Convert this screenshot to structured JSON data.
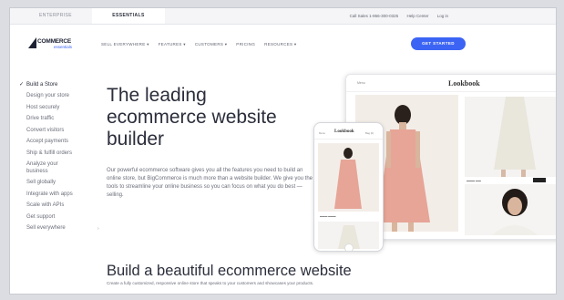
{
  "utility_bar": {
    "tabs": [
      {
        "label": "ENTERPRISE"
      },
      {
        "label": "ESSENTIALS"
      }
    ],
    "right_links": [
      {
        "label": "Call Sales 1-866-300-0325"
      },
      {
        "label": "Help Center"
      },
      {
        "label": "Log in"
      }
    ]
  },
  "header": {
    "logo": {
      "wordmark": "COMMERCE",
      "sub": "essentials"
    },
    "nav": [
      {
        "label": "SELL EVERYWHERE ▾"
      },
      {
        "label": "FEATURES ▾"
      },
      {
        "label": "CUSTOMERS ▾"
      },
      {
        "label": "PRICING"
      },
      {
        "label": "RESOURCES ▾"
      }
    ],
    "cta": "GET STARTED"
  },
  "sidebar": {
    "items": [
      {
        "label": "Build a Store",
        "active": true
      },
      {
        "label": "Design your store"
      },
      {
        "label": "Host securely"
      },
      {
        "label": "Drive traffic"
      },
      {
        "label": "Convert visitors"
      },
      {
        "label": "Accept payments"
      },
      {
        "label": "Ship & fulfill orders"
      },
      {
        "label": "Analyze your business"
      },
      {
        "label": "Sell globally"
      },
      {
        "label": "Integrate with apps"
      },
      {
        "label": "Scale with APIs"
      },
      {
        "label": "Get support"
      },
      {
        "label": "Sell everywhere"
      }
    ],
    "check_glyph": "✓",
    "chevron_glyph": "›"
  },
  "hero": {
    "title_line1": "The leading",
    "title_line2": "ecommerce website",
    "title_line3": "builder",
    "body": "Our powerful ecommerce software gives you all the features you need to build an online store, but BigCommerce is much more than a website builder. We give you the tools to streamline your online business so you can focus on what you do best — selling."
  },
  "section2": {
    "title": "Build a beautiful ecommerce website",
    "body": "Create a fully customized, responsive online store that speaks to your customers and showcases your products."
  },
  "mockups": {
    "desktop_title": "Lookbook",
    "desktop_menu": "Menu",
    "phone_title": "Lookbook",
    "phone_menu": "Menu",
    "phone_cart": "Bag (0)"
  },
  "colors": {
    "accent": "#3c64f4",
    "text_dark": "#2b2e3b",
    "text_muted": "#6b6e7a"
  }
}
